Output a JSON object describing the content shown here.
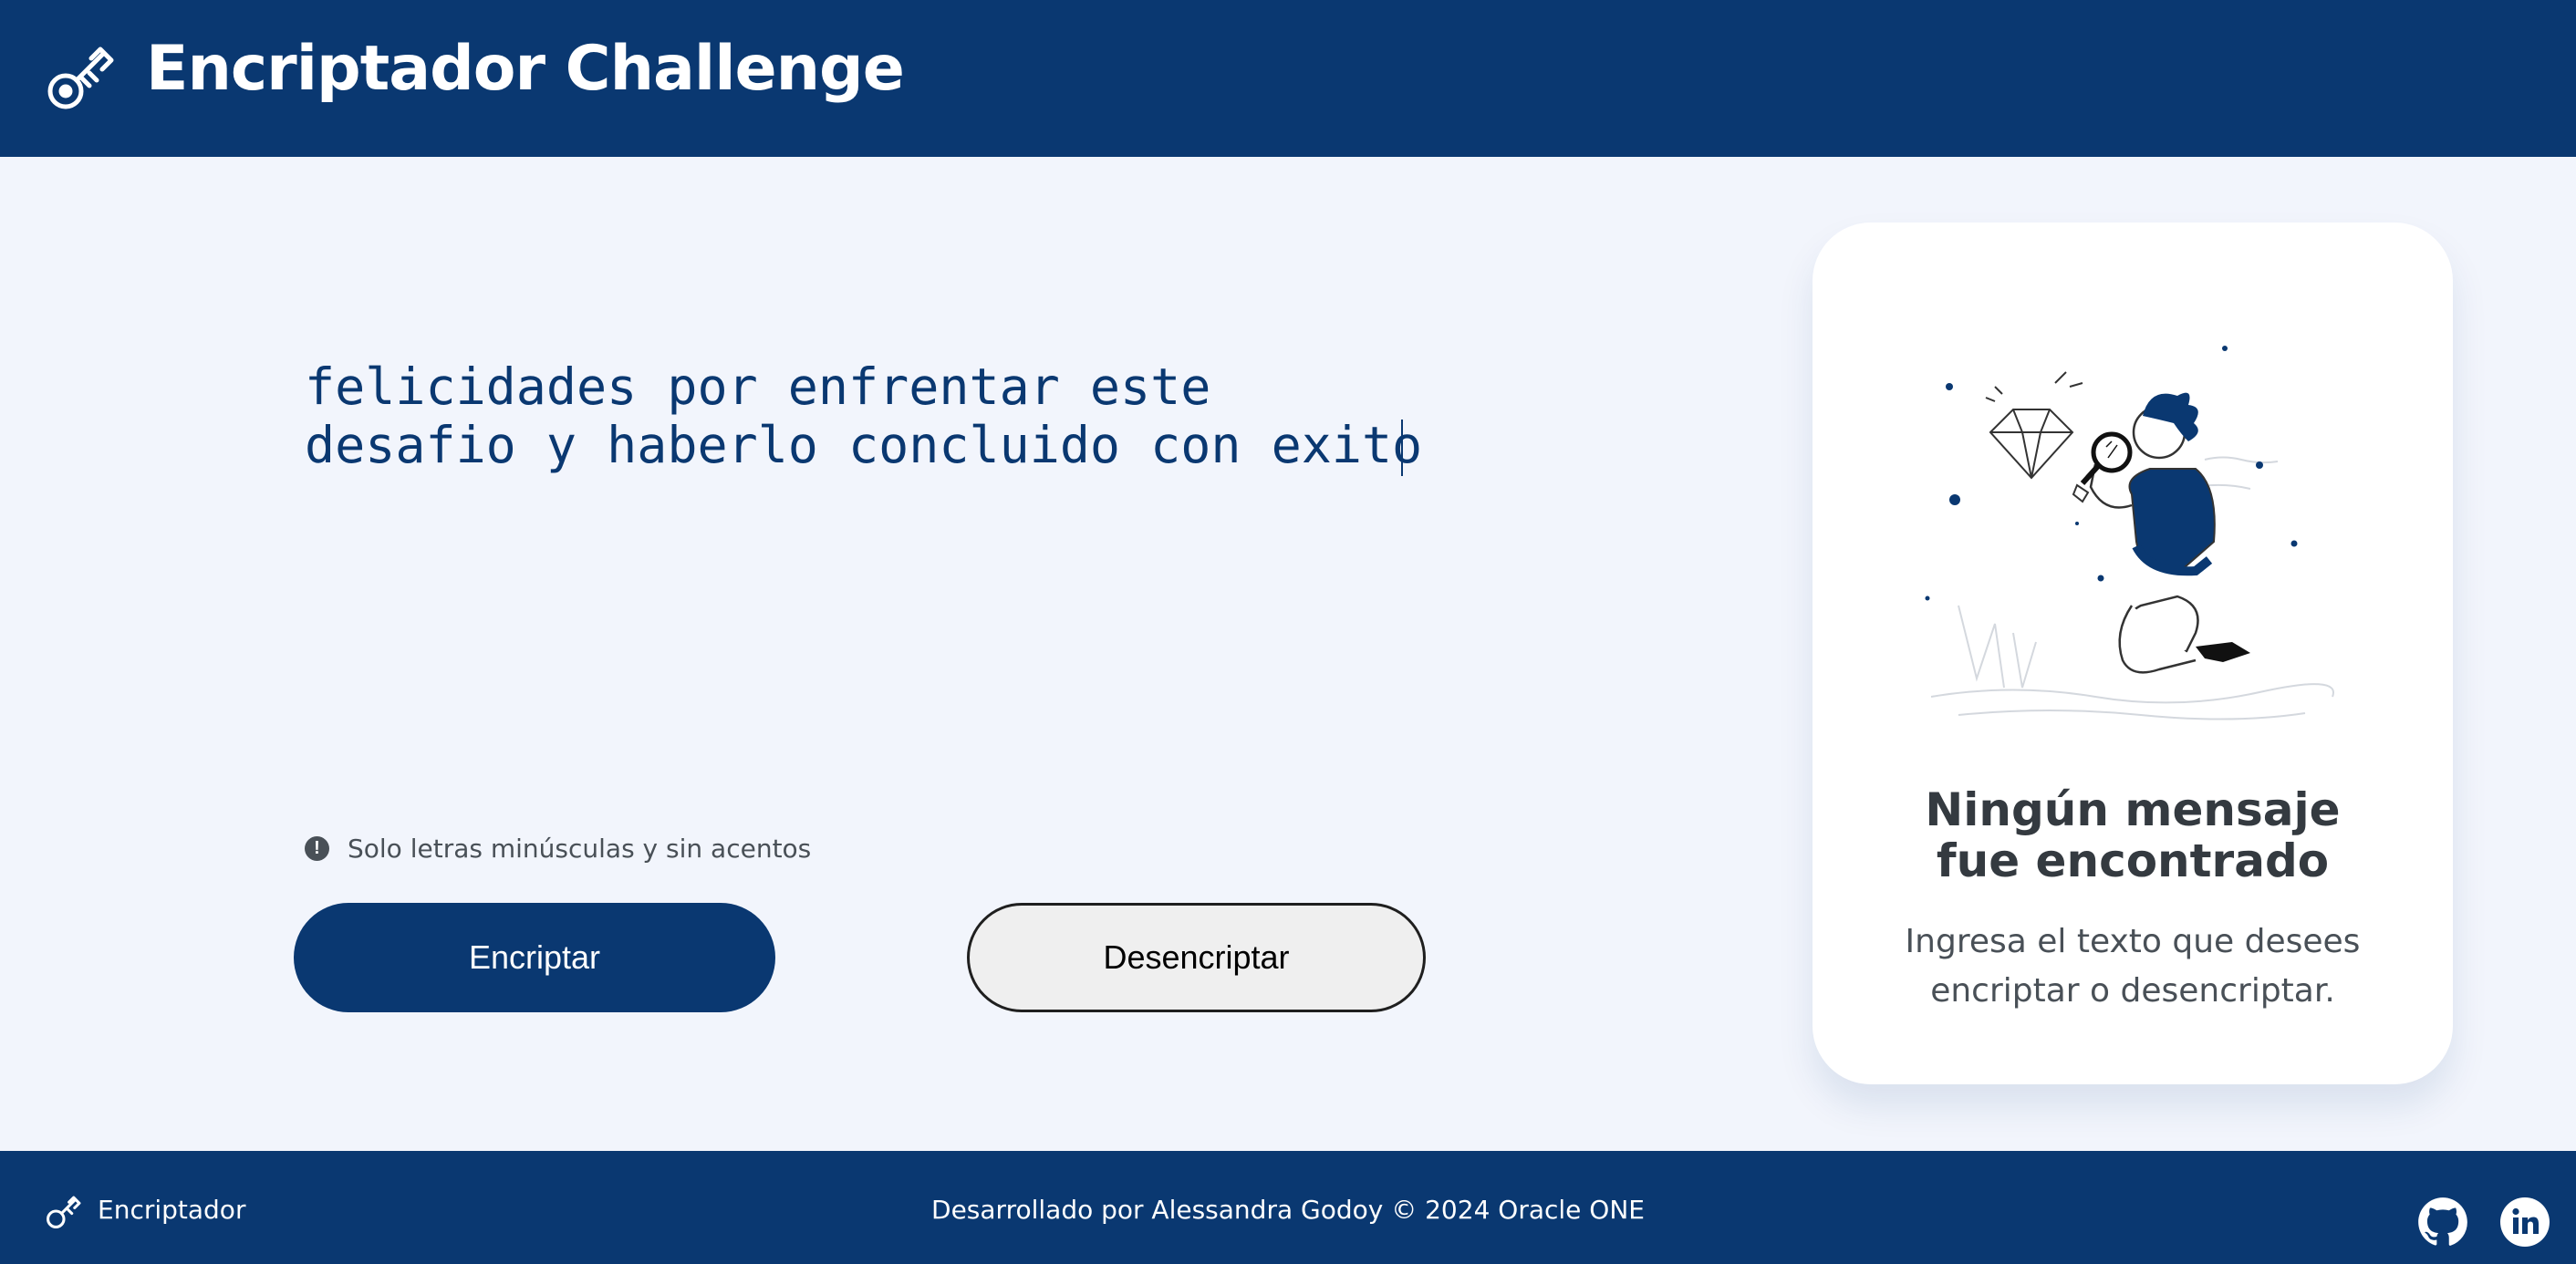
{
  "header": {
    "logo_icon": "key-icon",
    "title": "Encriptador Challenge"
  },
  "editor": {
    "value": "felicidades por enfrentar este\ndesafio y haberlo concluido con exito"
  },
  "hint": {
    "icon": "info-icon",
    "text": "Solo letras minúsculas y sin acentos"
  },
  "buttons": {
    "encrypt_label": "Encriptar",
    "decrypt_label": "Desencriptar"
  },
  "result_card": {
    "illustration": "person-with-magnifying-glass-illustration",
    "title": "Ningún mensaje fue encontrado",
    "description": "Ingresa el texto que desees encriptar o desencriptar."
  },
  "footer": {
    "brand": "Encriptador",
    "credit": "Desarrollado por Alessandra Godoy © 2024 Oracle ONE",
    "social": [
      "github-icon",
      "linkedin-icon"
    ]
  },
  "colors": {
    "primary": "#0a3871",
    "background": "#f2f5fc",
    "card": "#ffffff",
    "text_dark": "#343a40",
    "text_muted": "#495057"
  }
}
